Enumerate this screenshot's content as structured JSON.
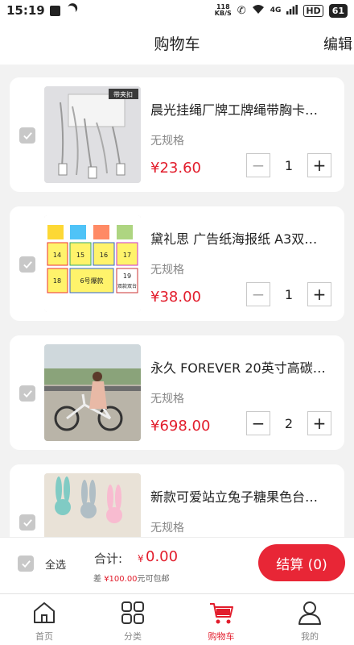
{
  "status_bar": {
    "time": "15:19",
    "net_speed_value": "118",
    "net_speed_unit": "KB/S",
    "signal_label": "4G",
    "battery": "61"
  },
  "header": {
    "title": "购物车",
    "edit_label": "编辑"
  },
  "cart": {
    "items": [
      {
        "name": "晨光挂绳厂牌工牌绳带胸卡…",
        "spec": "无规格",
        "price": "¥23.60",
        "quantity": "1",
        "image": "lanyard-product-photo",
        "tag": "带夹扣",
        "selected": false
      },
      {
        "name": "黛礼思 广告纸海报纸 A3双…",
        "spec": "无规格",
        "price": "¥38.00",
        "quantity": "1",
        "image": "poster-paper-product-photo",
        "labels": [
          "14",
          "15",
          "16",
          "17",
          "18",
          "6号爆款",
          "19",
          "双款双台"
        ],
        "selected": false
      },
      {
        "name": "永久 FOREVER 20英寸高碳…",
        "spec": "无规格",
        "price": "¥698.00",
        "quantity": "2",
        "image": "folding-bicycle-product-photo",
        "selected": false
      },
      {
        "name": "新款可爱站立兔子糖果色台…",
        "spec": "无规格",
        "image": "bunny-figurines-product-photo",
        "selected": false
      }
    ]
  },
  "summary": {
    "select_all_label": "全选",
    "total_label": "合计:",
    "currency": "¥",
    "total_value": "0.00",
    "shipping_prefix": "差",
    "shipping_amount": "¥100.00",
    "shipping_suffix": "元可包邮",
    "checkout_label": "结算 (0)"
  },
  "tabbar": {
    "tabs": [
      {
        "label": "首页",
        "icon": "home-icon"
      },
      {
        "label": "分类",
        "icon": "category-grid-icon"
      },
      {
        "label": "购物车",
        "icon": "cart-icon",
        "active": true
      },
      {
        "label": "我的",
        "icon": "user-icon"
      }
    ]
  },
  "colors": {
    "accent": "#e21d2c",
    "checkout_button": "#e82636",
    "checkbox_unchecked": "#c8c8c8"
  }
}
